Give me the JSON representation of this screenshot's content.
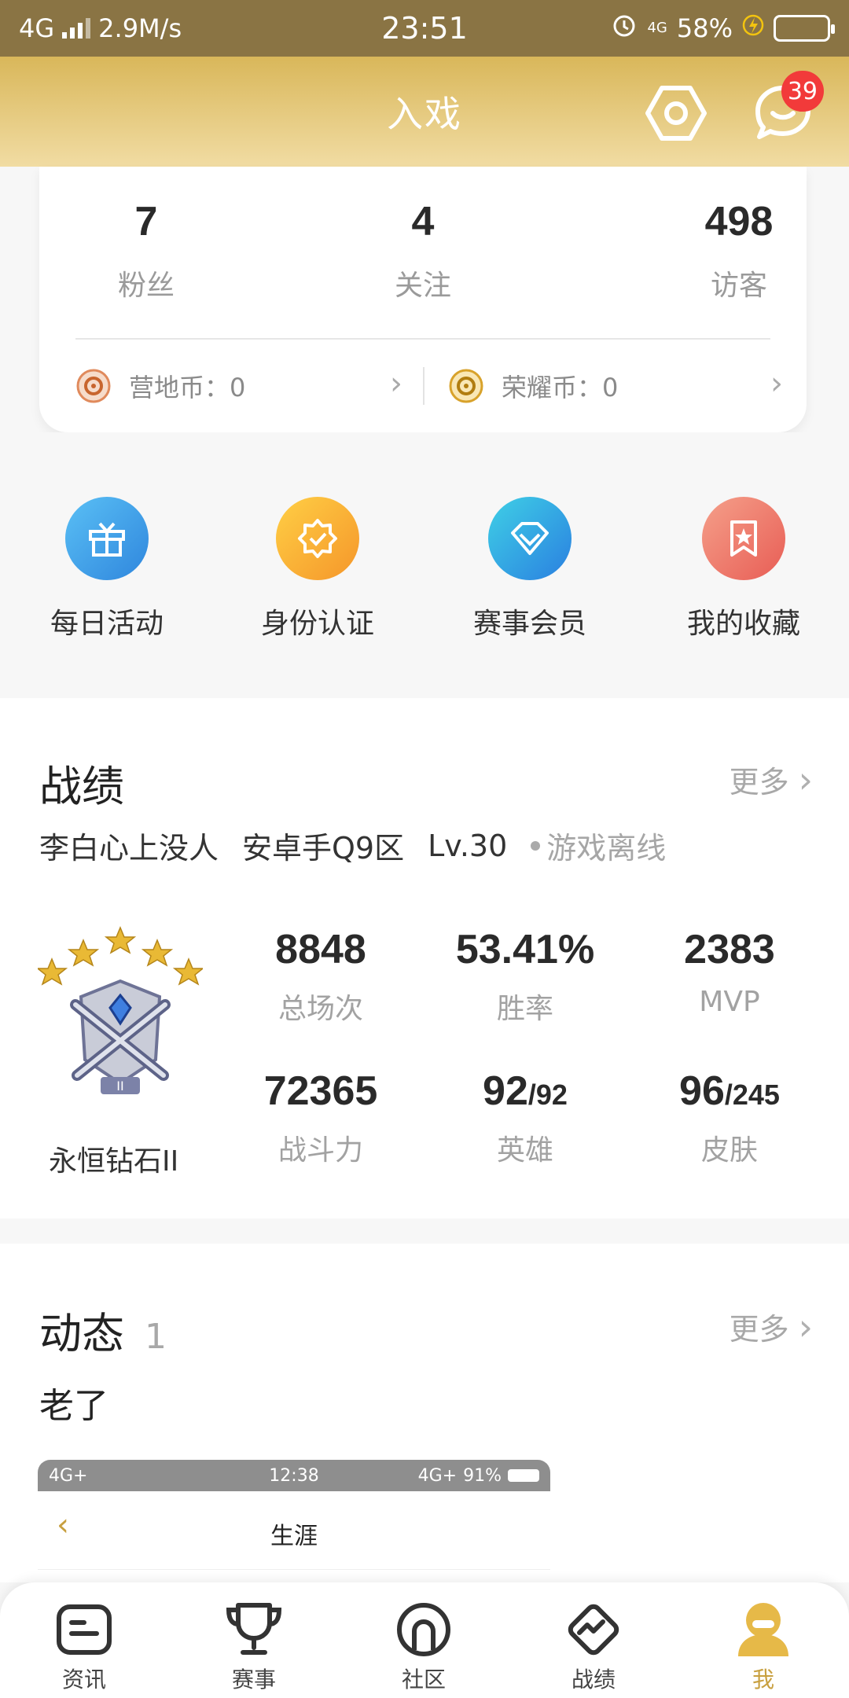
{
  "status_bar": {
    "network": "4G",
    "speed": "2.9M/s",
    "time": "23:51",
    "net2": "4G",
    "battery": "58%",
    "battery_level": 0.58
  },
  "header": {
    "title": "入戏",
    "message_badge": "39"
  },
  "profile_stats": {
    "fans": {
      "value": "7",
      "label": "粉丝"
    },
    "following": {
      "value": "4",
      "label": "关注"
    },
    "visitors": {
      "value": "498",
      "label": "访客"
    },
    "camp_coin": "营地币：0",
    "honor_coin": "荣耀币：0"
  },
  "quick_actions": [
    {
      "label": "每日活动",
      "icon": "gift-icon",
      "color": "#3aa0e6"
    },
    {
      "label": "身份认证",
      "icon": "verify-badge-icon",
      "color": "#f5a623"
    },
    {
      "label": "赛事会员",
      "icon": "diamond-icon",
      "color": "#2d9ee0"
    },
    {
      "label": "我的收藏",
      "icon": "bookmark-star-icon",
      "color": "#ec7a6a"
    }
  ],
  "record": {
    "title": "战绩",
    "more": "更多",
    "player": "李白心上没人",
    "server": "安卓手Q9区",
    "level": "Lv.30",
    "status": "游戏离线",
    "rank": "永恒钻石II",
    "rank_stars": 5,
    "stats": [
      {
        "value": "8848",
        "label": "总场次"
      },
      {
        "value": "53.41%",
        "label": "胜率"
      },
      {
        "value": "2383",
        "label": "MVP"
      },
      {
        "value": "72365",
        "label": "战斗力"
      },
      {
        "value": "92",
        "suffix": "/92",
        "label": "英雄"
      },
      {
        "value": "96",
        "suffix": "/245",
        "label": "皮肤"
      }
    ]
  },
  "feed": {
    "title": "动态",
    "count": "1",
    "more": "更多",
    "post_text": "老了",
    "thumb": {
      "net": "4G+",
      "time": "12:38",
      "net2": "4G+",
      "battery": "91%",
      "title": "生涯"
    }
  },
  "tabs": [
    {
      "label": "资讯",
      "icon": "news-icon"
    },
    {
      "label": "赛事",
      "icon": "trophy-icon"
    },
    {
      "label": "社区",
      "icon": "community-icon"
    },
    {
      "label": "战绩",
      "icon": "chart-diamond-icon"
    },
    {
      "label": "我",
      "icon": "profile-icon",
      "active": true
    }
  ]
}
